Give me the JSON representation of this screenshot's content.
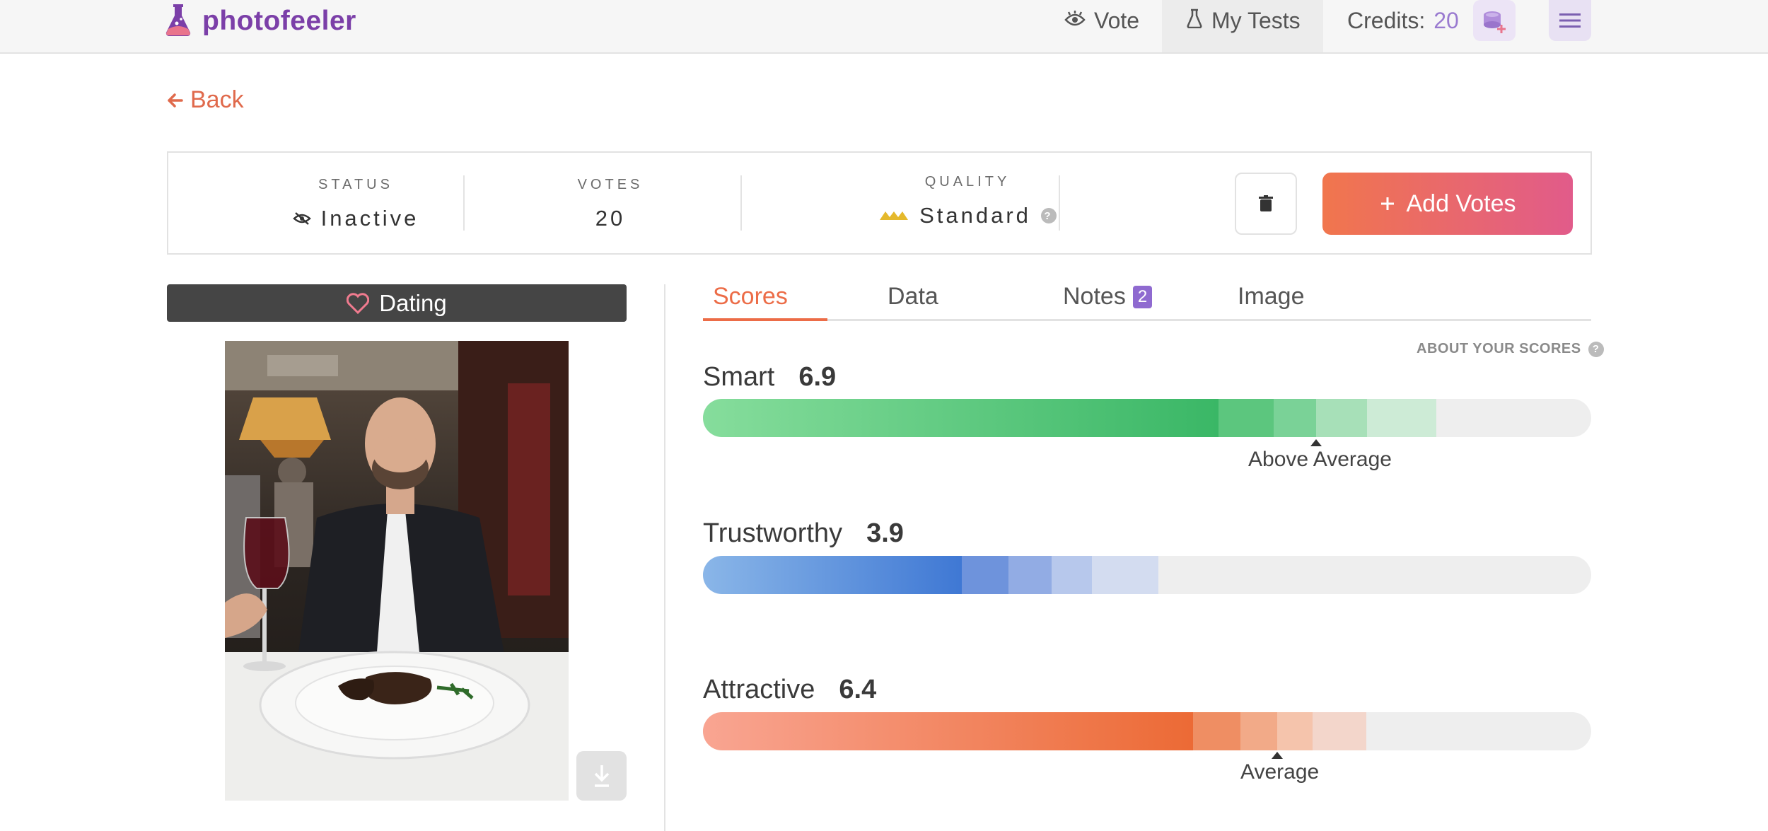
{
  "nav": {
    "logo_text": "photofeeler",
    "vote_label": "Vote",
    "tests_label": "My Tests",
    "credits_label": "Credits:",
    "credits_value": "20"
  },
  "back_label": "Back",
  "status_card": {
    "status_label": "STATUS",
    "status_value": "Inactive",
    "votes_label": "VOTES",
    "votes_value": "20",
    "quality_label": "QUALITY",
    "quality_value": "Standard",
    "add_votes_label": "Add Votes"
  },
  "category_label": "Dating",
  "tabs": [
    {
      "label": "Scores",
      "active": true
    },
    {
      "label": "Data",
      "active": false
    },
    {
      "label": "Notes",
      "badge": "2",
      "active": false
    },
    {
      "label": "Image",
      "active": false
    }
  ],
  "about_scores": "ABOUT YOUR SCORES",
  "scores": [
    {
      "name": "Smart",
      "value": "6.9",
      "marker_label": "Above Average",
      "fill_fraction": 0.58
    },
    {
      "name": "Trustworthy",
      "value": "3.9",
      "marker_label": "",
      "fill_fraction": 0.29
    },
    {
      "name": "Attractive",
      "value": "6.4",
      "marker_label": "Average",
      "fill_fraction": 0.55
    }
  ],
  "colors": {
    "accent": "#ec6c47",
    "purple": "#7b3fa8",
    "smart": "#3fbf6e",
    "trustworthy": "#4a86d8",
    "attractive": "#ee6f3c"
  }
}
